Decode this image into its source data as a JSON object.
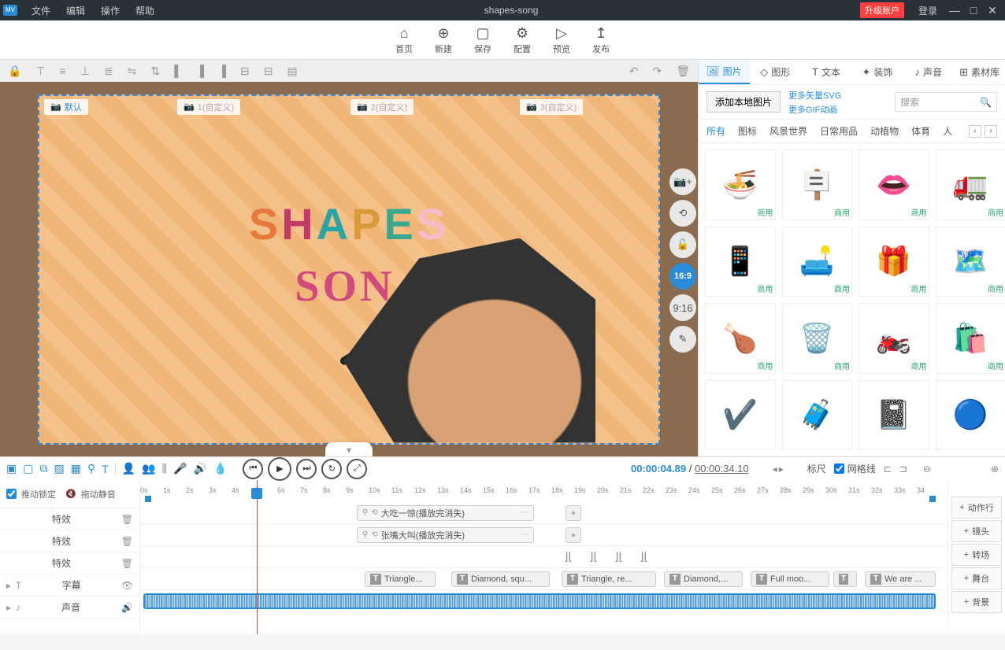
{
  "titlebar": {
    "logo": "MV",
    "menu": [
      "文件",
      "编辑",
      "操作",
      "帮助"
    ],
    "title": "shapes-song",
    "upgrade": "升级账户",
    "login": "登录"
  },
  "main_toolbar": [
    {
      "icon": "⌂",
      "label": "首页"
    },
    {
      "icon": "⊕",
      "label": "新建"
    },
    {
      "icon": "▢",
      "label": "保存"
    },
    {
      "icon": "⚙",
      "label": "配置"
    },
    {
      "icon": "▷",
      "label": "预览"
    },
    {
      "icon": "↥",
      "label": "发布"
    }
  ],
  "canvas": {
    "cameras": [
      {
        "label": "默认",
        "active": true
      },
      {
        "label": "1(自定义)",
        "active": false
      },
      {
        "label": "2(自定义)",
        "active": false
      },
      {
        "label": "3(自定义)",
        "active": false
      }
    ],
    "text1": "SHAPES",
    "text2": "SON",
    "side_buttons": [
      "📷+",
      "⟲",
      "🔓",
      "16:9",
      "9:16",
      "✎"
    ],
    "active_ratio": "16:9"
  },
  "right_panel": {
    "tabs": [
      {
        "icon": "🖼",
        "label": "图片",
        "active": true
      },
      {
        "icon": "◇",
        "label": "图形"
      },
      {
        "icon": "T",
        "label": "文本"
      },
      {
        "icon": "✦",
        "label": "装饰"
      },
      {
        "icon": "♪",
        "label": "声音"
      },
      {
        "icon": "⊞",
        "label": "素材库"
      }
    ],
    "add_button": "添加本地图片",
    "links": [
      "更多矢量SVG",
      "更多GIF动画"
    ],
    "search_placeholder": "搜索",
    "categories": [
      "所有",
      "图标",
      "风景世界",
      "日常用品",
      "动植物",
      "体育",
      "人"
    ],
    "active_category": "所有",
    "items": [
      {
        "emoji": "🍜",
        "tag": "商用"
      },
      {
        "emoji": "🪧",
        "tag": "商用"
      },
      {
        "emoji": "👄",
        "tag": "商用"
      },
      {
        "emoji": "🚛",
        "tag": "商用"
      },
      {
        "emoji": "📱",
        "tag": "商用"
      },
      {
        "emoji": "🛋️",
        "tag": "商用"
      },
      {
        "emoji": "🎁",
        "tag": "商用"
      },
      {
        "emoji": "🗺️",
        "tag": "商用"
      },
      {
        "emoji": "🍗",
        "tag": "商用"
      },
      {
        "emoji": "🗑️",
        "tag": "商用"
      },
      {
        "emoji": "🏍️",
        "tag": "商用"
      },
      {
        "emoji": "🛍️",
        "tag": "商用"
      },
      {
        "emoji": "✔️",
        "tag": ""
      },
      {
        "emoji": "🧳",
        "tag": ""
      },
      {
        "emoji": "📓",
        "tag": ""
      },
      {
        "emoji": "🔵",
        "tag": ""
      }
    ]
  },
  "playback": {
    "current": "00:00:04.89",
    "sep": " / ",
    "total": "00:00:34.10",
    "ruler_label": "标尺",
    "grid_label": "网格线",
    "grid_checked": true
  },
  "timeline": {
    "push_lock": "推动锁定",
    "drag_mute": "拖动静音",
    "ruler_ticks": [
      "0s",
      "1s",
      "2s",
      "3s",
      "4s",
      "5s",
      "6s",
      "7s",
      "8s",
      "9s",
      "10s",
      "11s",
      "12s",
      "13s",
      "14s",
      "15s",
      "16s",
      "17s",
      "18s",
      "19s",
      "20s",
      "21s",
      "22s",
      "23s",
      "24s",
      "25s",
      "26s",
      "27s",
      "28s",
      "29s",
      "30s",
      "31s",
      "32s",
      "33s",
      "34"
    ],
    "rows": {
      "effects": "特效",
      "subtitle": "字幕",
      "sound": "声音"
    },
    "effect_clips": [
      {
        "label": "大吃一惊(播放完消失)"
      },
      {
        "label": "张嘴大叫(播放完消失)"
      }
    ],
    "subtitle_clips": [
      "Triangle...",
      "Diamond, squ...",
      "Triangle, re...",
      "Diamond,...",
      "Full moo...",
      "",
      "We are ..."
    ],
    "right_buttons": [
      "动作行",
      "镜头",
      "转场",
      "舞台",
      "背景"
    ]
  }
}
